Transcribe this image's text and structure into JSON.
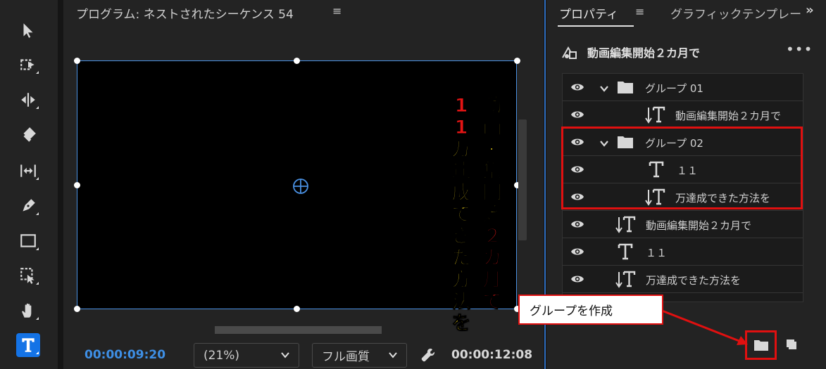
{
  "program": {
    "title": "プログラム: ネストされたシーケンス 54",
    "menu": "≡",
    "vertical_text": {
      "right_column": [
        {
          "ch": "動",
          "color": "yellow"
        },
        {
          "ch": "画",
          "color": "yellow"
        },
        {
          "ch": "編",
          "color": "yellow"
        },
        {
          "ch": "集",
          "color": "yellow"
        },
        {
          "ch": "開",
          "color": "yellow"
        },
        {
          "ch": "始",
          "color": "yellow"
        },
        {
          "ch": "２",
          "color": "red"
        },
        {
          "ch": "カ",
          "color": "red"
        },
        {
          "ch": "月",
          "color": "red"
        },
        {
          "ch": "で",
          "color": "red"
        }
      ],
      "left_column": [
        {
          "ch": "1",
          "color": "red"
        },
        {
          "ch": "1",
          "color": "red"
        },
        {
          "ch": "万",
          "color": "yellow"
        },
        {
          "ch": "達",
          "color": "yellow"
        },
        {
          "ch": "成",
          "color": "yellow"
        },
        {
          "ch": "で",
          "color": "yellow"
        },
        {
          "ch": "き",
          "color": "yellow"
        },
        {
          "ch": "た",
          "color": "yellow"
        },
        {
          "ch": "方",
          "color": "yellow"
        },
        {
          "ch": "法",
          "color": "yellow"
        },
        {
          "ch": "を",
          "color": "yellow"
        }
      ]
    },
    "timecode_current": "00:00:09:20",
    "zoom": "(21%)",
    "quality": "フル画質",
    "timecode_duration": "00:00:12:08"
  },
  "properties": {
    "tab_label": "プロパティ",
    "tab_menu": "≡",
    "other_tab": "グラフィックテンプレート",
    "overflow": "»",
    "header_title": "動画編集開始２カ月で",
    "more": "•••",
    "layers": [
      {
        "label": "グループ 01",
        "kind": "group",
        "indent": 0
      },
      {
        "label": "動画編集開始２カ月で",
        "kind": "vertical-text",
        "indent": 1
      },
      {
        "label": "グループ 02",
        "kind": "group",
        "indent": 0
      },
      {
        "label": "１１",
        "kind": "text",
        "indent": 2
      },
      {
        "label": "万達成できた方法を",
        "kind": "vertical-text",
        "indent": 1
      },
      {
        "label": "動画編集開始２カ月で",
        "kind": "vertical-text",
        "indent": 0
      },
      {
        "label": "１１",
        "kind": "text",
        "indent": 0
      },
      {
        "label": "万達成できた方法を",
        "kind": "vertical-text",
        "indent": 0
      }
    ]
  },
  "callout": {
    "text": "グループを作成"
  },
  "colors": {
    "accent_blue": "#3e8fe5",
    "highlight_red": "#e01010",
    "text_yellow": "#ffe01b",
    "text_red": "#e31414"
  }
}
